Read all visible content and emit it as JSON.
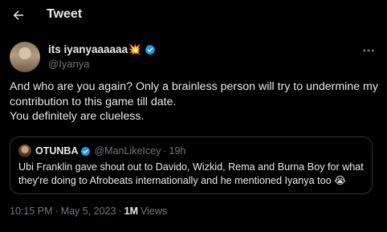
{
  "header": {
    "title": "Tweet",
    "back_icon": "arrow-left-icon"
  },
  "author": {
    "display_name": "its iyanyaaaaaa",
    "emoji": "💥",
    "handle": "@Iyanya",
    "verified_color": "#1d9bf0"
  },
  "tweet": {
    "lines": [
      "And who are you again? Only a brainless person will try to undermine my",
      "contribution to this game till date.",
      "You definitely are clueless."
    ]
  },
  "quote": {
    "display_name": "OTUNBA",
    "handle": "@ManLikeIcey",
    "separator": "·",
    "time": "19h",
    "lines": [
      "Ubi Franklin gave shout out to Davido, Wizkid, Rema and Burna Boy for what",
      "they're doing to Afrobeats internationally and he mentioned Iyanya too 😭"
    ]
  },
  "meta": {
    "time": "10:15 PM",
    "separator": "·",
    "date": "May 5, 2023",
    "views_count": "1M",
    "views_label": "Views"
  },
  "colors": {
    "background": "#000000",
    "text": "#e7e9ea",
    "muted": "#71767b",
    "accent": "#1d9bf0",
    "border": "#2f3336"
  }
}
